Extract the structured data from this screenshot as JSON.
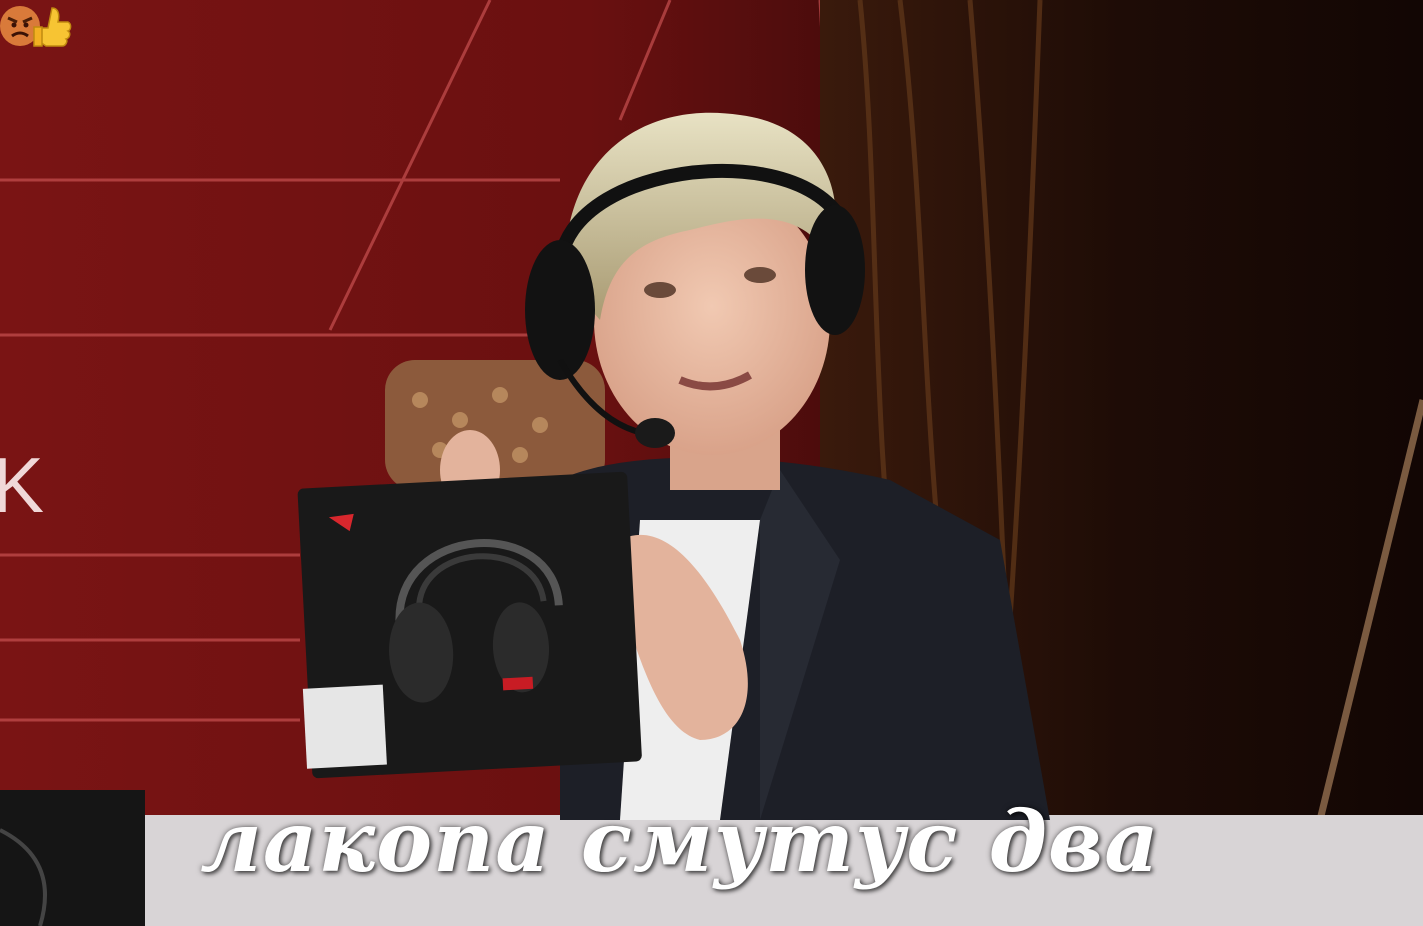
{
  "caption": "лакопа смутус два",
  "stage_text": "K",
  "colors": {
    "stage_red": "#6e1414",
    "curtain": "#2a1208",
    "caption": "#ffffff"
  },
  "sticker": {
    "icons": [
      "angry-face-icon",
      "thumbs-up-icon"
    ]
  }
}
